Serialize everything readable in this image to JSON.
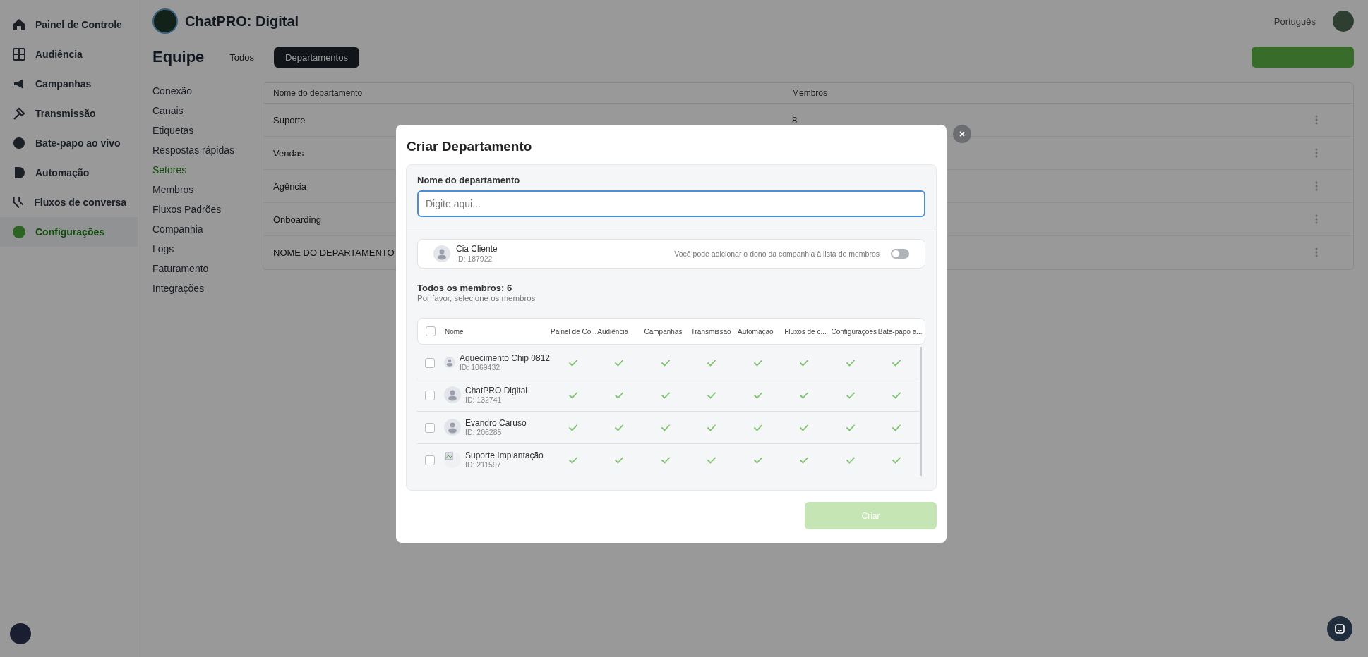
{
  "sidebar": {
    "items": [
      {
        "label": "Painel de Controle",
        "selected": false
      },
      {
        "label": "Audiência",
        "selected": false
      },
      {
        "label": "Campanhas",
        "selected": false
      },
      {
        "label": "Transmissão",
        "selected": false
      },
      {
        "label": "Bate-papo ao vivo",
        "selected": false
      },
      {
        "label": "Automação",
        "selected": false
      },
      {
        "label": "Fluxos de conversa",
        "selected": false
      },
      {
        "label": "Configurações",
        "selected": true
      }
    ]
  },
  "header": {
    "brand": "ChatPRO: Digital",
    "language": "Português"
  },
  "page": {
    "title": "Equipe",
    "tabs": [
      {
        "label": "Todos",
        "selected": false
      },
      {
        "label": "Departamentos",
        "selected": true
      }
    ]
  },
  "settings_menu": [
    {
      "label": "Conexão",
      "selected": false
    },
    {
      "label": "Canais",
      "selected": false
    },
    {
      "label": "Etiquetas",
      "selected": false
    },
    {
      "label": "Respostas rápidas",
      "selected": false
    },
    {
      "label": "Setores",
      "selected": true
    },
    {
      "label": "Membros",
      "selected": false
    },
    {
      "label": "Fluxos Padrões",
      "selected": false
    },
    {
      "label": "Companhia",
      "selected": false
    },
    {
      "label": "Logs",
      "selected": false
    },
    {
      "label": "Faturamento",
      "selected": false
    },
    {
      "label": "Integrações",
      "selected": false
    }
  ],
  "departments_table": {
    "columns": [
      "Nome do departamento",
      "Membros"
    ],
    "rows": [
      {
        "name": "Suporte",
        "members": "8"
      },
      {
        "name": "Vendas"
      },
      {
        "name": "Agência"
      },
      {
        "name": "Onboarding"
      },
      {
        "name": "NOME DO DEPARTAMENTO"
      }
    ]
  },
  "modal": {
    "title": "Criar Departamento",
    "name_field": {
      "label": "Nome do departamento",
      "placeholder": "Digite aqui..."
    },
    "owner": {
      "name": "Cia Cliente",
      "id": "ID: 187922",
      "note": "Você pode adicionar o dono da companhia à lista de membros",
      "on": false
    },
    "members": {
      "summary": "Todos os membros: 6",
      "hint": "Por favor, selecione os membros",
      "select_all": false,
      "columns": [
        "Nome",
        "Painel de Co...",
        "Audiência",
        "Campanhas",
        "Transmissão",
        "Automação",
        "Fluxos de c...",
        "Configurações",
        "Bate-papo a..."
      ],
      "rows": [
        {
          "name": "Aquecimento Chip 0812",
          "id": "ID: 1069432",
          "checked": false,
          "kind": "silhouette",
          "permissions": [
            true,
            true,
            true,
            true,
            true,
            true,
            true,
            true
          ]
        },
        {
          "name": "ChatPRO Digital",
          "id": "ID: 132741",
          "checked": false,
          "kind": "silhouette",
          "permissions": [
            true,
            true,
            true,
            true,
            true,
            true,
            true,
            true
          ]
        },
        {
          "name": "Evandro Caruso",
          "id": "ID: 206285",
          "checked": false,
          "kind": "silhouette",
          "permissions": [
            true,
            true,
            true,
            true,
            true,
            true,
            true,
            true
          ]
        },
        {
          "name": "Suporte Implantação",
          "id": "ID: 211597",
          "checked": false,
          "kind": "broken",
          "permissions": [
            true,
            true,
            true,
            true,
            true,
            true,
            true,
            true
          ]
        }
      ]
    },
    "submit": {
      "label": "Criar",
      "disabled": true
    }
  }
}
